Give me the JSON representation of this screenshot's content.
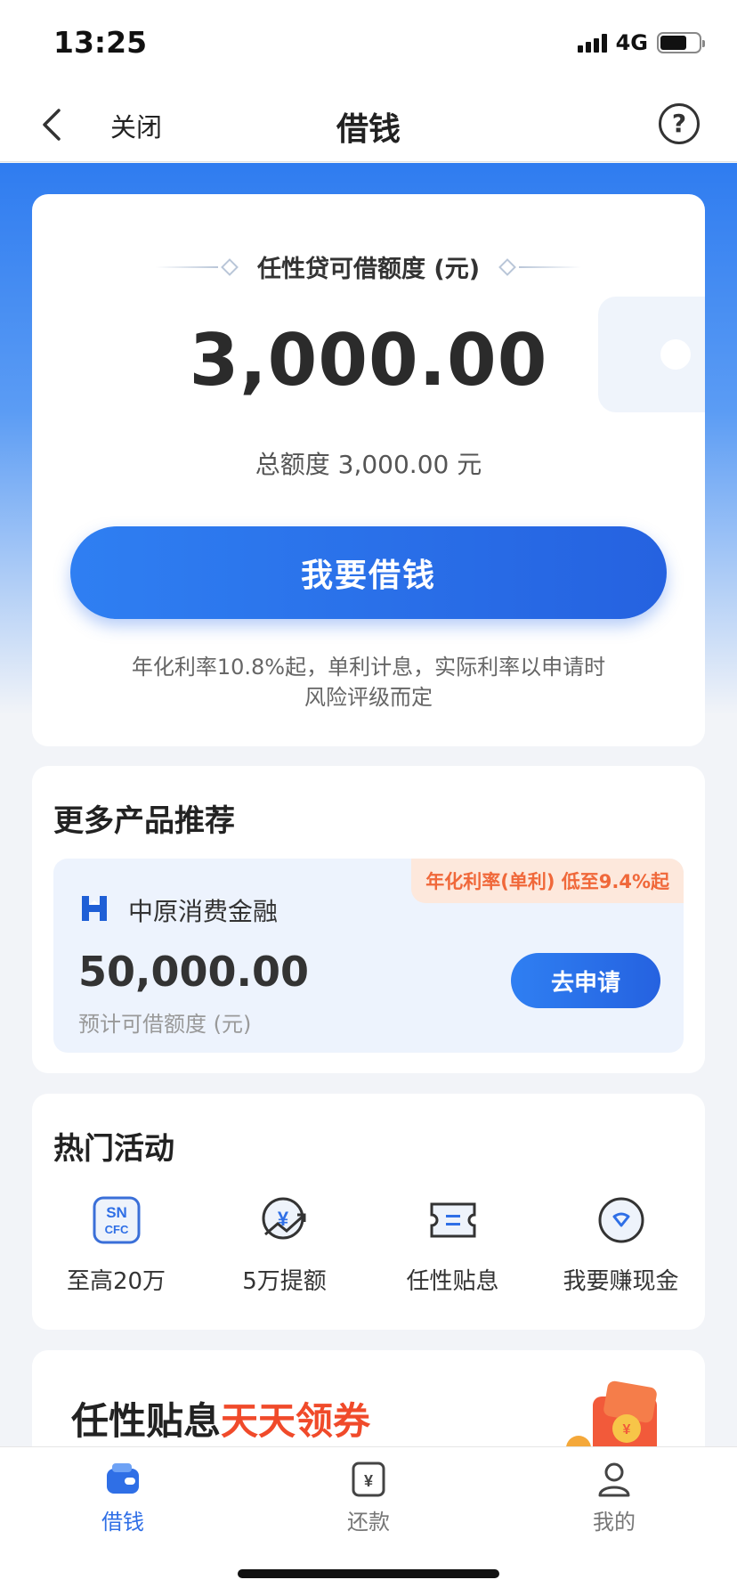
{
  "status_bar": {
    "time": "13:25",
    "network": "4G"
  },
  "nav": {
    "close_label": "关闭",
    "title": "借钱",
    "help_symbol": "?"
  },
  "credit_card": {
    "label": "任性贷可借额度 (元)",
    "amount": "3,000.00",
    "total_text": "总额度 3,000.00 元",
    "borrow_button": "我要借钱",
    "note": "年化利率10.8%起，单利计息，实际利率以申请时风险评级而定"
  },
  "more_products": {
    "title": "更多产品推荐",
    "product": {
      "name": "中原消费金融",
      "rate_tag": "年化利率(单利) 低至9.4%起",
      "amount": "50,000.00",
      "amount_label": "预计可借额度 (元)",
      "apply_button": "去申请"
    }
  },
  "hot_activities": {
    "title": "热门活动",
    "items": [
      {
        "label": "至高20万",
        "icon": "sncfc-logo-icon"
      },
      {
        "label": "5万提额",
        "icon": "yen-arrow-icon"
      },
      {
        "label": "任性贴息",
        "icon": "coupon-icon"
      },
      {
        "label": "我要赚现金",
        "icon": "heart-badge-icon"
      }
    ]
  },
  "banner": {
    "text_black": "任性贴息",
    "text_red": "天天领券"
  },
  "tabbar": {
    "items": [
      {
        "label": "借钱",
        "icon": "wallet-icon",
        "active": true
      },
      {
        "label": "还款",
        "icon": "yen-bill-icon",
        "active": false
      },
      {
        "label": "我的",
        "icon": "person-icon",
        "active": false
      }
    ]
  },
  "colors": {
    "accent": "#2f6fe6",
    "tag_orange": "#f0683a",
    "banner_red": "#f04a2a"
  }
}
